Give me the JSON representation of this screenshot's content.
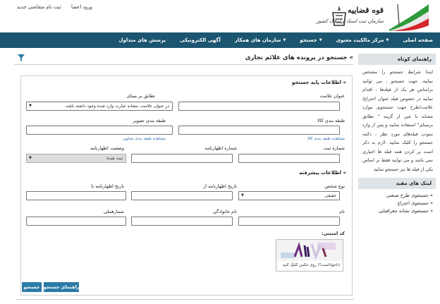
{
  "top_links": {
    "login": "ورود اعضا",
    "register": "ثبت نام متقاضی جدید"
  },
  "logo": {
    "title": "قوه قضاییه",
    "subtitle": "سازمان ثبت اسناد و املاک کشور"
  },
  "nav": [
    {
      "label": "صفحه اصلی",
      "dropdown": false
    },
    {
      "label": "مرکز مالکیت معنوی",
      "dropdown": true
    },
    {
      "label": "جستجو",
      "dropdown": true
    },
    {
      "label": "سازمان های همکار",
      "dropdown": true
    },
    {
      "label": "آگهی الکترونیکی",
      "dropdown": false
    },
    {
      "label": "پرسش های متداول",
      "dropdown": false
    }
  ],
  "page": {
    "title": "جستجو در پرونده های علائم تجاری",
    "title_arrow": "»"
  },
  "basic": {
    "heading": "اطلاعات پایه جستجو",
    "mark_title_label": "عنوان علامت",
    "match_label": "تطابق بر مبنای",
    "match_value": "در عنوان علامت، مشابه عبارت وارد شده وجود داشته باشد.",
    "goods_class_label": "طبقه بندی کالا",
    "image_class_label": "طبقه بندی تصویر",
    "goods_class_link": "مشاهده طبقه بندی کالا",
    "image_class_link": "مشاهده طبقه بندی تصاویر",
    "reg_no_label": "شماره ثبت",
    "decl_no_label": "شماره اظهارنامه",
    "decl_status_label": "وضعیت اظهارنامه",
    "decl_status_value": "ثبت شده"
  },
  "advanced": {
    "heading": "اطلاعات پیشرفته",
    "person_type_label": "نوع شخص",
    "person_type_value": "حقیقی",
    "date_from_label": "تاریخ اظهارنامه از",
    "date_to_label": "تاریخ اظهارنامه تا",
    "first_name_label": "نام",
    "last_name_label": "نام خانوادگی",
    "national_id_label": "شمارهملی"
  },
  "captcha": {
    "label": "کد امنیتی:",
    "hint": "(ناخواناست؟) روی عکس کلیک کنید"
  },
  "buttons": {
    "search": "جستجو",
    "guide": "راهنمای جستجو"
  },
  "sidebar": {
    "guide_title": "راهنمای کوتاه",
    "guide_text": "ابتدا شرایط جستجو را مشخص نمایید. جهت جستجو ، می توانید براساس هر یک از فیلدها ، اقدام نمایید در خصوص فیلد عنوان اختراع/علامت/طرح جهت جستجوی موارد مشابه با عین از گزینه \" تطابق برمبنای\" استفاده نمایید و پس از وارد نمودن فیلدهای مورد نظر ، دکمه جستجو را کلیک نمایید .لازم به ذکر است پر کردن همه فیلد ها اجباری نمی باشد و می توانید فقط بر اساس یکی از فیلد ها نیز جستجو نمایید",
    "links_title": "لینک های مفید",
    "links": [
      "جستجوی طرح صنعتی",
      "جستجوی اختراع",
      "جستجوی نشانه جغرافیایی"
    ]
  }
}
